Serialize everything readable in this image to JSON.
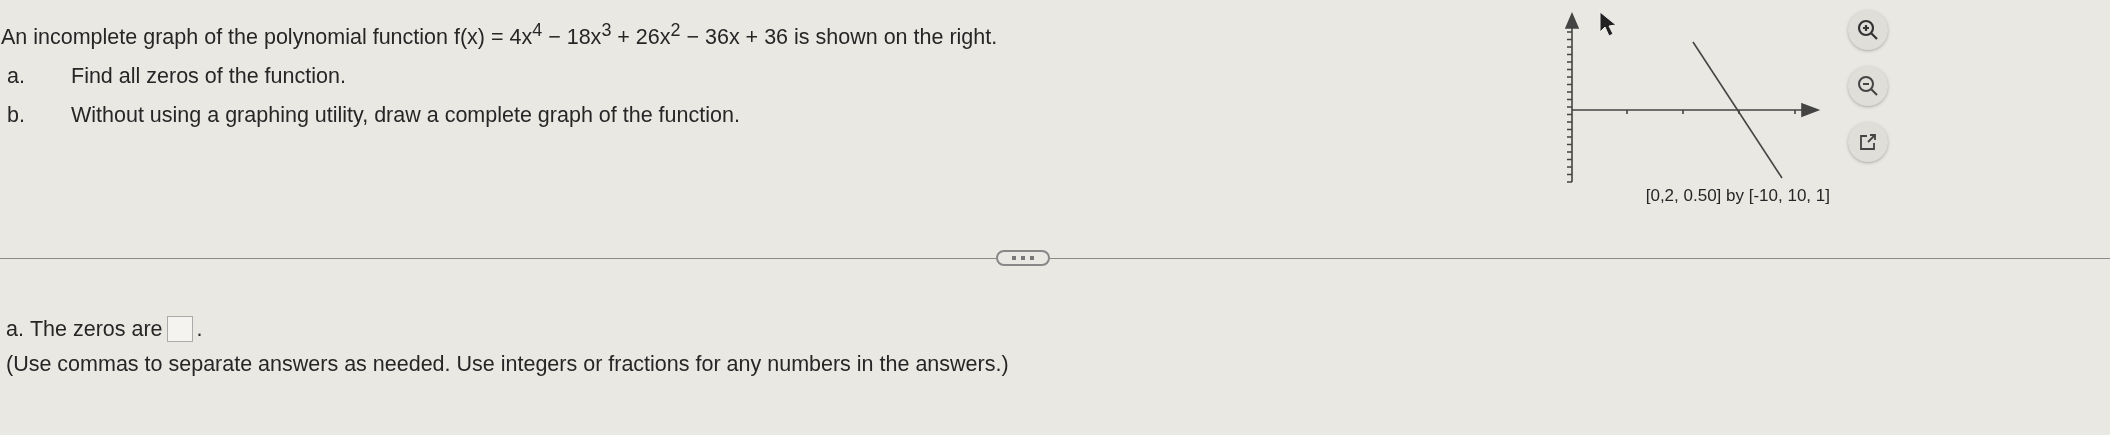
{
  "question": {
    "intro": "An incomplete graph of the polynomial function f(x) = 4x$^{4}$ − 18x$^{3}$ + 26x$^{2}$ − 36x + 36 is shown on the right.",
    "parts": [
      {
        "letter": "a.",
        "text": "Find all zeros of the function."
      },
      {
        "letter": "b.",
        "text": "Without using a graphing utility, draw a complete graph of the function."
      }
    ]
  },
  "graph": {
    "window_label": "[0,2, 0.50] by [-10, 10, 1]"
  },
  "answer": {
    "letter": "a.",
    "prompt": "The zeros are",
    "after": ".",
    "note": "(Use commas to separate answers as needed. Use integers or fractions for any numbers in the answers.)"
  }
}
